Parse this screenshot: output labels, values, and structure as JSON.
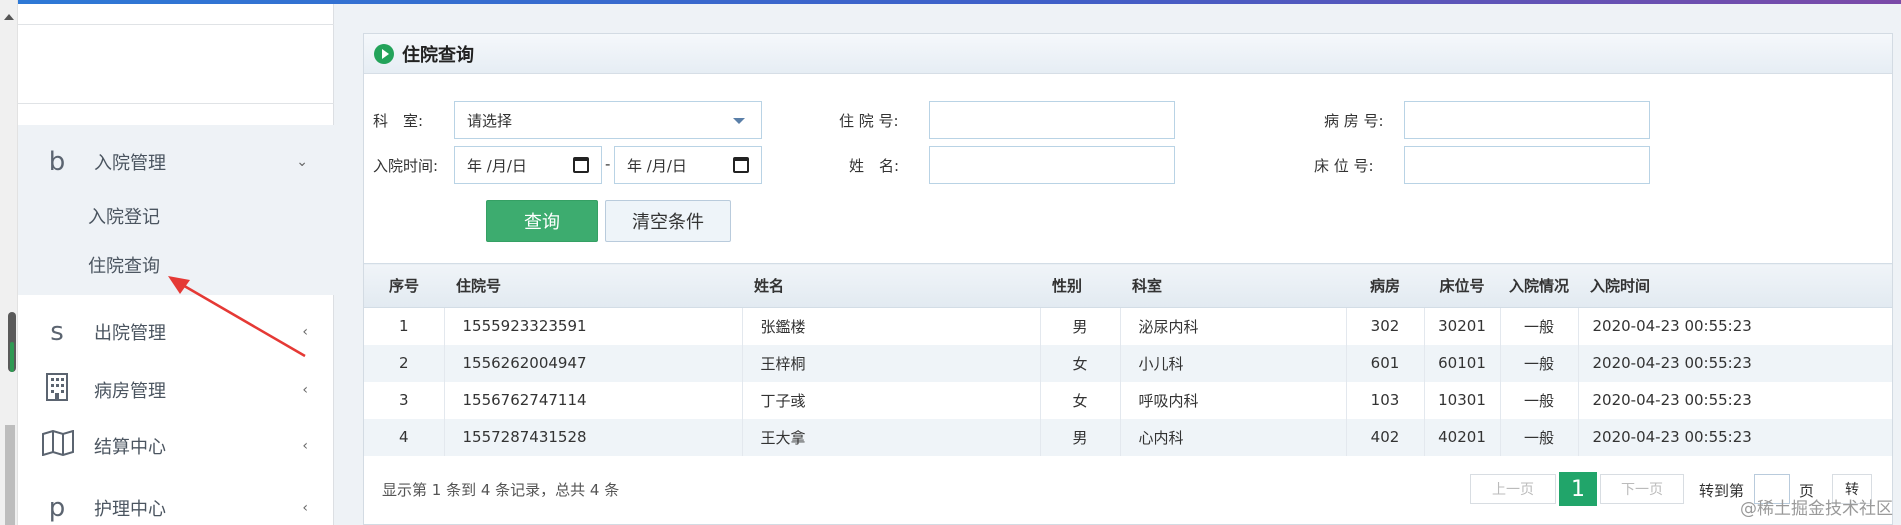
{
  "sidebar": {
    "groups": [
      {
        "icon": "b",
        "label": "入院管理",
        "chevron": "⌄"
      },
      {
        "icon": "s",
        "label": "出院管理",
        "chevron": "‹"
      },
      {
        "icon": "building",
        "label": "病房管理",
        "chevron": "‹"
      },
      {
        "icon": "map",
        "label": "结算中心",
        "chevron": "‹"
      },
      {
        "icon": "p",
        "label": "护理中心",
        "chevron": "‹"
      }
    ],
    "submenu": [
      "入院登记",
      "住院查询"
    ]
  },
  "panel": {
    "title": "住院查询"
  },
  "filters": {
    "dept_label": "科　室:",
    "dept_value": "请选择",
    "admit_time_label": "入院时间:",
    "date_start": "年 /月/日",
    "date_sep": "-",
    "date_end": "年 /月/日",
    "inpatient_no_label": "住 院 号:",
    "name_label": "姓　名:",
    "ward_no_label": "病 房 号:",
    "bed_no_label": "床 位 号:",
    "search_button": "查询",
    "clear_button": "清空条件"
  },
  "table": {
    "headers": [
      "序号",
      "住院号",
      "姓名",
      "性别",
      "科室",
      "病房",
      "床位号",
      "入院情况",
      "入院时间"
    ],
    "rows": [
      [
        "1",
        "1555923323591",
        "张鑑楼",
        "男",
        "泌尿内科",
        "302",
        "30201",
        "一般",
        "2020-04-23 00:55:23"
      ],
      [
        "2",
        "1556262004947",
        "王梓桐",
        "女",
        "小儿科",
        "601",
        "60101",
        "一般",
        "2020-04-23 00:55:23"
      ],
      [
        "3",
        "1556762747114",
        "丁子彧",
        "女",
        "呼吸内科",
        "103",
        "10301",
        "一般",
        "2020-04-23 00:55:23"
      ],
      [
        "4",
        "1557287431528",
        "王大拿",
        "男",
        "心内科",
        "402",
        "40201",
        "一般",
        "2020-04-23 00:55:23"
      ]
    ]
  },
  "pagination": {
    "info": "显示第 1 条到 4 条记录，总共 4 条",
    "prev": "上一页",
    "current": "1",
    "next": "下一页",
    "goto_label": "转到第",
    "page_suffix": "页",
    "go_button": "转"
  },
  "watermark": "@稀土掘金技术社区",
  "colors": {
    "primary": "#3dac6f",
    "accent_arrow": "#e53935",
    "topbar": "#2e79d6"
  }
}
